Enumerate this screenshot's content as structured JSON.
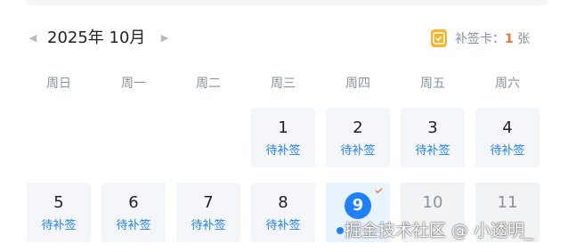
{
  "header": {
    "prev_icon": "chevron-left-icon",
    "next_icon": "chevron-right-icon",
    "month_title": "2025年 10月",
    "card_label": "补签卡：",
    "card_count": "1",
    "card_unit": "张",
    "card_icon": "sign-card-icon"
  },
  "weekdays": [
    "周日",
    "周一",
    "周二",
    "周三",
    "周四",
    "周五",
    "周六"
  ],
  "days": [
    {
      "num": "1",
      "status": "待补签"
    },
    {
      "num": "2",
      "status": "待补签"
    },
    {
      "num": "3",
      "status": "待补签"
    },
    {
      "num": "4",
      "status": "待补签"
    },
    {
      "num": "5",
      "status": "待补签"
    },
    {
      "num": "6",
      "status": "待补签"
    },
    {
      "num": "7",
      "status": "待补签"
    },
    {
      "num": "8",
      "status": "待补签"
    },
    {
      "num": "9",
      "status": ""
    },
    {
      "num": "10",
      "status": ""
    },
    {
      "num": "11",
      "status": ""
    }
  ],
  "watermark": "掘金技术社区 @ 小透明_",
  "colors": {
    "accent": "#1e80ff",
    "check": "#f0883e",
    "card": "#f7b52c",
    "card_count": "#e8782f"
  }
}
